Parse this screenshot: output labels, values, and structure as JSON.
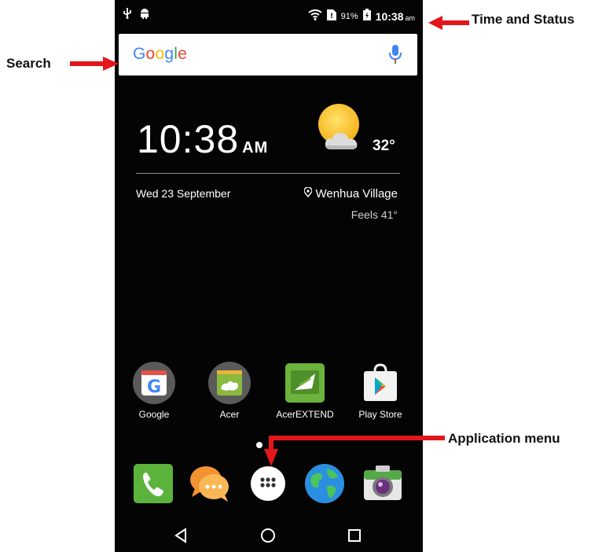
{
  "status_bar": {
    "battery_percent": "91%",
    "time": "10:38",
    "ampm": "am"
  },
  "search": {
    "logo_text": "Google"
  },
  "clock_widget": {
    "time": "10:38",
    "ampm": "AM",
    "temperature": "32°",
    "date": "Wed 23 September",
    "location": "Wenhua Village",
    "feels_like": "Feels 41°"
  },
  "apps": [
    {
      "label": "Google",
      "icon": "google-icon"
    },
    {
      "label": "Acer",
      "icon": "acer-icon"
    },
    {
      "label": "AcerEXTEND",
      "icon": "acerextend-icon"
    },
    {
      "label": "Play Store",
      "icon": "play-store-icon"
    }
  ],
  "dock": [
    {
      "icon": "phone-icon"
    },
    {
      "icon": "messaging-icon"
    },
    {
      "icon": "app-drawer-icon"
    },
    {
      "icon": "browser-globe-icon"
    },
    {
      "icon": "camera-icon"
    }
  ],
  "annotations": {
    "time_and_status": "Time and Status",
    "search": "Search",
    "application_menu": "Application menu"
  },
  "colors": {
    "annotation_arrow": "#e3161b",
    "screen_background": "#040404"
  }
}
